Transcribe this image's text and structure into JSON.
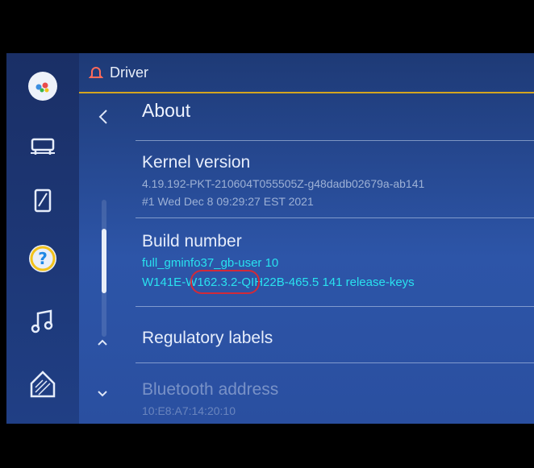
{
  "top_bar": {
    "title": "Driver"
  },
  "about": {
    "header": "About",
    "kernel": {
      "title": "Kernel version",
      "line1": "4.19.192-PKT-210604T055505Z-g48dadb02679a-ab141",
      "line2": "#1 Wed Dec 8 09:29:27 EST 2021"
    },
    "build": {
      "title": "Build number",
      "line1": "full_gminfo37_gb-user 10",
      "line2": "W141E-W162.3.2-QIH22B-465.5 141 release-keys"
    },
    "regulatory": {
      "title": "Regulatory labels"
    },
    "bluetooth": {
      "title": "Bluetooth address",
      "value": "10:E8:A7:14:20:10"
    }
  },
  "colors": {
    "accent": "#d4a520",
    "highlight": "#29e2ef",
    "annotation": "#d22a38"
  }
}
